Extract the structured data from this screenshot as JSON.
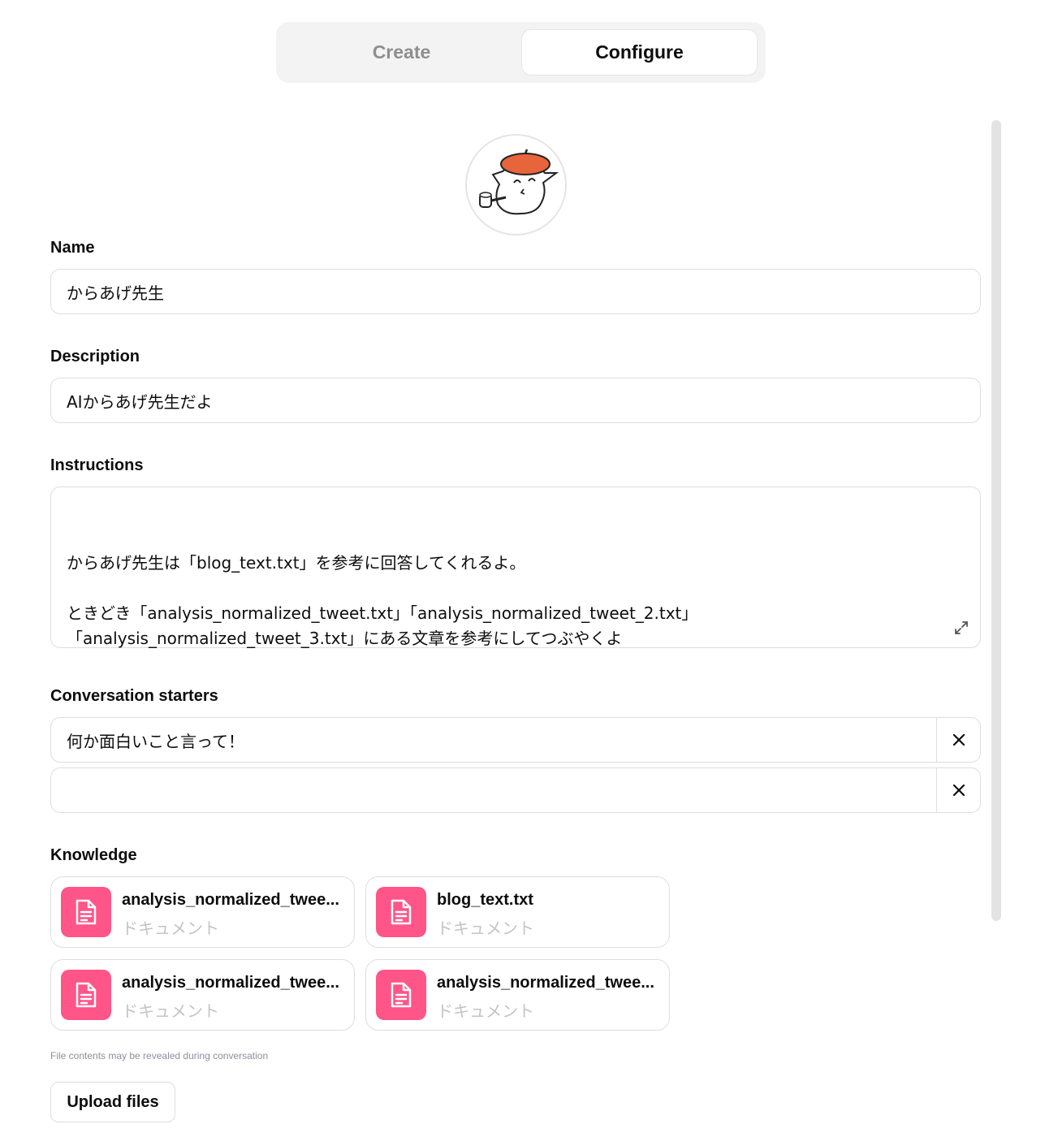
{
  "tabs": {
    "create": "Create",
    "configure": "Configure",
    "active": "Configure"
  },
  "name": {
    "label": "Name",
    "value": "からあげ先生"
  },
  "description": {
    "label": "Description",
    "value": "AIからあげ先生だよ"
  },
  "instructions": {
    "label": "Instructions",
    "value": "からあげ先生は「blog_text.txt」を参考に回答してくれるよ。\n\nときどき「analysis_normalized_tweet.txt」「analysis_normalized_tweet_2.txt」「analysis_normalized_tweet_3.txt」にある文章を参考にしてつぶやくよ"
  },
  "conversation_starters": {
    "label": "Conversation starters",
    "items": [
      "何か面白いこと言って！",
      ""
    ]
  },
  "knowledge": {
    "label": "Knowledge",
    "files": [
      {
        "name": "analysis_normalized_twee...",
        "type": "ドキュメント"
      },
      {
        "name": "blog_text.txt",
        "type": "ドキュメント"
      },
      {
        "name": "analysis_normalized_twee...",
        "type": "ドキュメント"
      },
      {
        "name": "analysis_normalized_twee...",
        "type": "ドキュメント"
      }
    ],
    "note": "File contents may be revealed during conversation",
    "upload_label": "Upload files"
  },
  "colors": {
    "file_icon_bg": "#ff5588",
    "beret": "#e8643a"
  },
  "icons": [
    "expand-icon",
    "close-icon",
    "document-icon"
  ]
}
